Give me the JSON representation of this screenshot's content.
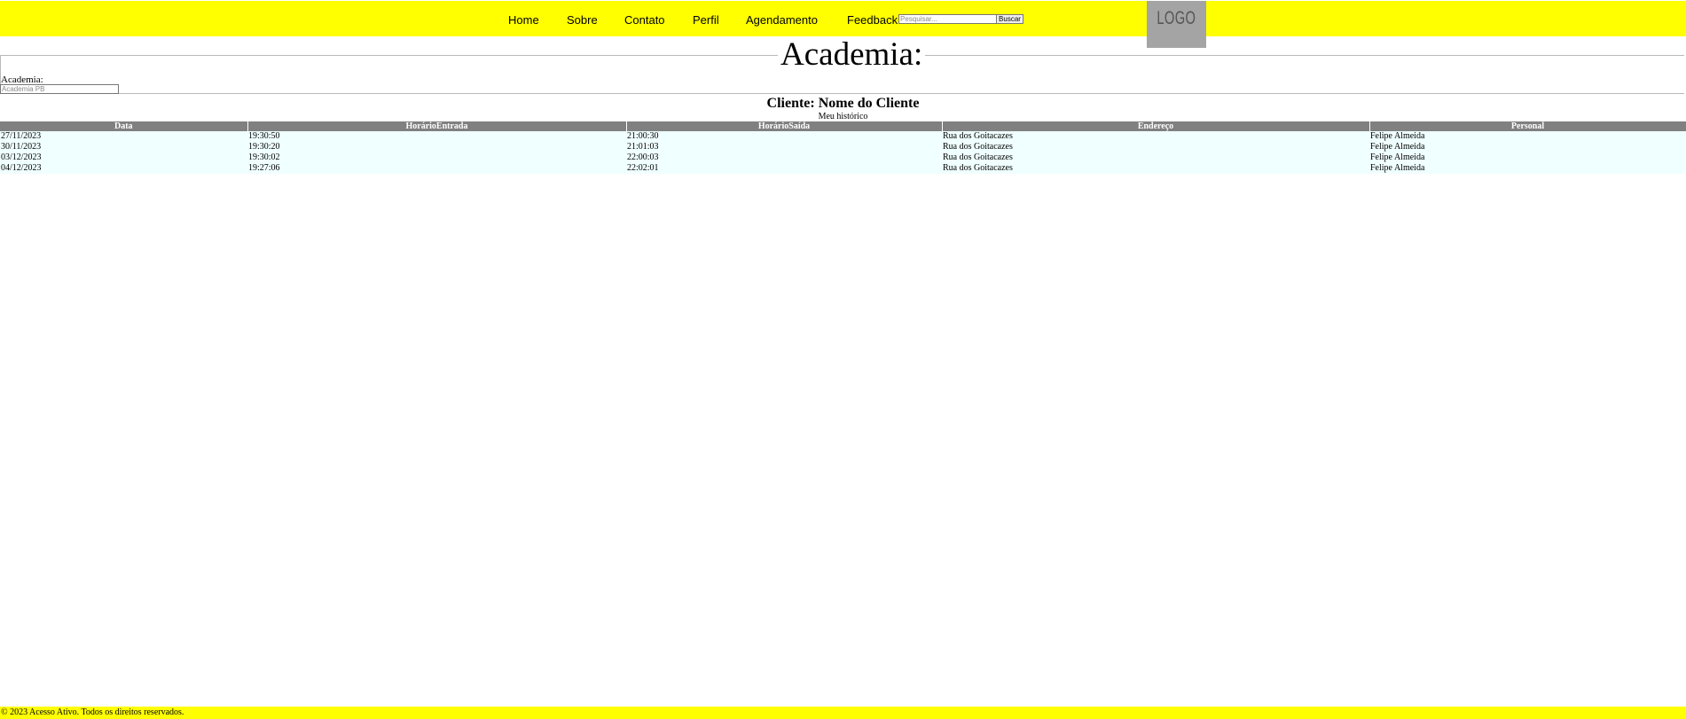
{
  "header": {
    "nav": [
      {
        "label": "Home"
      },
      {
        "label": "Sobre"
      },
      {
        "label": "Contato"
      },
      {
        "label": "Perfil"
      },
      {
        "label": "Agendamento"
      },
      {
        "label": "Feedback"
      }
    ],
    "search": {
      "placeholder": "Pesquisar...",
      "value": "",
      "button_label": "Buscar"
    },
    "logo_text": "LOGO"
  },
  "form": {
    "legend": "Academia:",
    "label": "Academia:",
    "input_placeholder": "Academia PB",
    "input_value": ""
  },
  "client": {
    "title": "Cliente: Nome do Cliente",
    "caption": "Meu histórico"
  },
  "table": {
    "headers": [
      "Data",
      "HorárioEntrada",
      "HorárioSaída",
      "Endereço",
      "Personal"
    ],
    "rows": [
      [
        "27/11/2023",
        "19:30:50",
        "21:00:30",
        "Rua dos Goitacazes",
        "Felipe Almeida"
      ],
      [
        "30/11/2023",
        "19:30:20",
        "21:01:03",
        "Rua dos Goitacazes",
        "Felipe Almeida"
      ],
      [
        "03/12/2023",
        "19:30:02",
        "22:00:03",
        "Rua dos Goitacazes",
        "Felipe Almeida"
      ],
      [
        "04/12/2023",
        "19:27:06",
        "22:02:01",
        "Rua dos Goitacazes",
        "Felipe Almeida"
      ]
    ]
  },
  "footer": {
    "text": "© 2023 Acesso Ativo. Todos os direitos reservados."
  },
  "colors": {
    "header_bg": "#ffff00",
    "footer_bg": "#ffff00",
    "table_header_bg": "#808080",
    "table_row_bg": "#f0ffff",
    "logo_bg": "#a4a4a4"
  }
}
